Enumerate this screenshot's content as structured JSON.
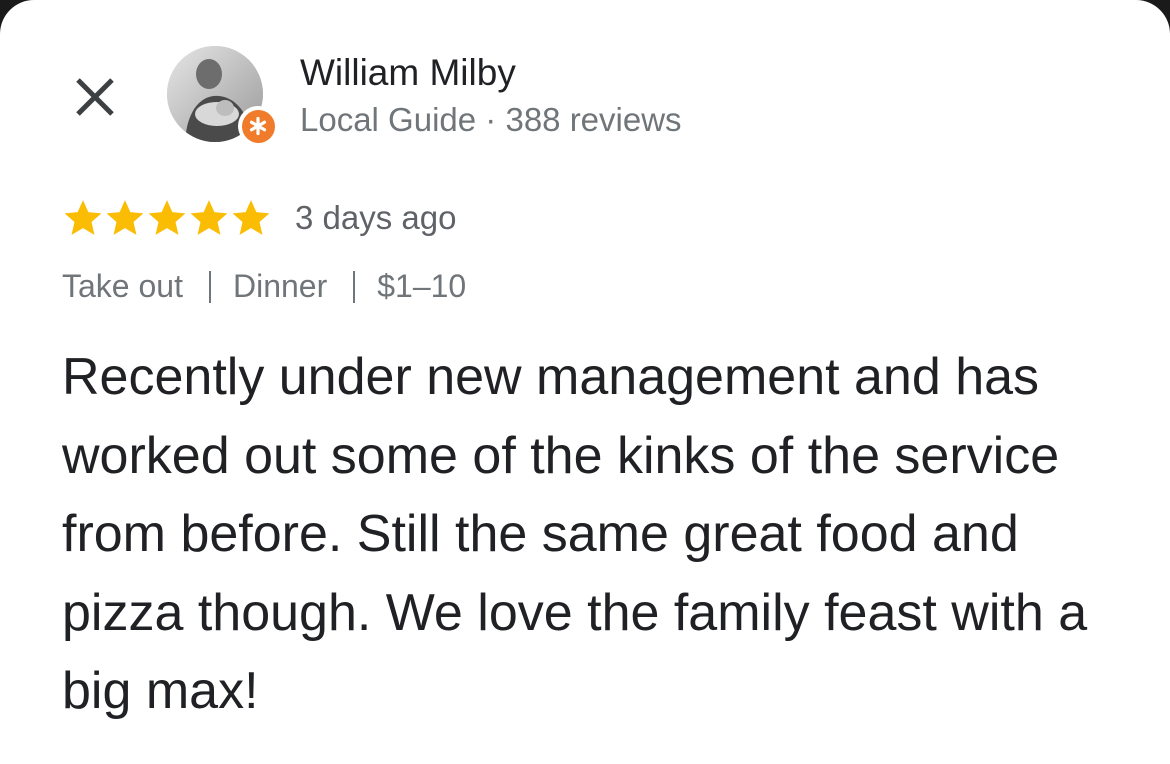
{
  "reviewer": {
    "name": "William Milby",
    "guide_label": "Local Guide",
    "separator": "·",
    "reviews_count": "388 reviews"
  },
  "review": {
    "rating": 5,
    "max_rating": 5,
    "time": "3 days ago",
    "tags": [
      "Take out",
      "Dinner",
      "$1–10"
    ],
    "text": "Recently under new management and has worked out some of the kinks of the service from before. Still the same great food and pizza though. We love the family feast with a big max!"
  },
  "icons": {
    "close": "close-icon",
    "badge": "local-guide-star-icon",
    "star": "star-icon"
  },
  "colors": {
    "star": "#fbbc04",
    "badge": "#f07b2a",
    "text_primary": "#202124",
    "text_secondary": "#70757a"
  }
}
